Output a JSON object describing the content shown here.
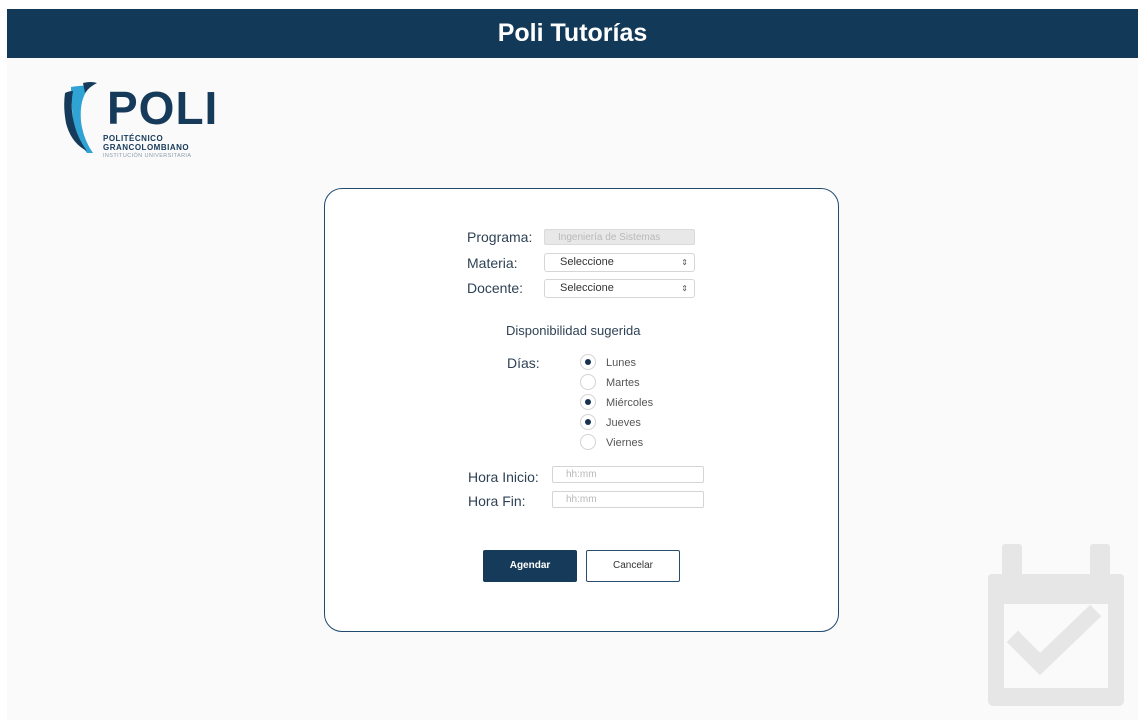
{
  "header": {
    "title": "Poli Tutorías"
  },
  "logo": {
    "brand": "POLI",
    "line1": "POLITÉCNICO",
    "line2": "GRANCOLOMBIANO",
    "line3": "INSTITUCIÓN UNIVERSITARIA"
  },
  "form": {
    "programa_label": "Programa:",
    "programa_value": "Ingeniería de Sistemas",
    "materia_label": "Materia:",
    "materia_value": "Seleccione",
    "docente_label": "Docente:",
    "docente_value": "Seleccione",
    "availability_title": "Disponibilidad sugerida",
    "dias_label": "Días:",
    "days": [
      {
        "label": "Lunes",
        "checked": true
      },
      {
        "label": "Martes",
        "checked": false
      },
      {
        "label": "Miércoles",
        "checked": true
      },
      {
        "label": "Jueves",
        "checked": true
      },
      {
        "label": "Viernes",
        "checked": false
      }
    ],
    "hora_inicio_label": "Hora Inicio:",
    "hora_inicio_placeholder": "hh:mm",
    "hora_fin_label": "Hora Fin:",
    "hora_fin_placeholder": "hh:mm",
    "agendar_label": "Agendar",
    "cancelar_label": "Cancelar"
  },
  "colors": {
    "primary": "#133959",
    "background": "#fafafa",
    "calendar_icon": "#e6e6e6"
  },
  "icons": {
    "decorative": "calendar-check-icon"
  }
}
